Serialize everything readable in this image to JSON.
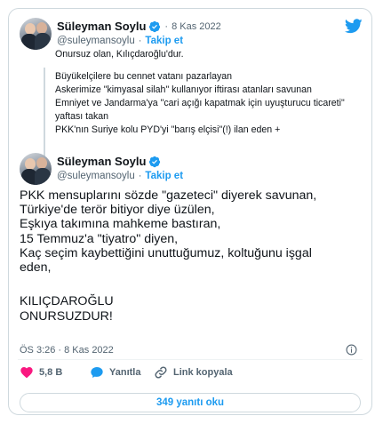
{
  "quoted_tweet": {
    "author_name": "Süleyman Soylu",
    "dot": "·",
    "date": "8 Kas 2022",
    "handle": "@suleymansoylu",
    "follow_label": "Takip et",
    "lines": [
      "Onursuz olan, Kılıçdaroğlu'dur.",
      "",
      "Büyükelçilere bu cennet vatanı pazarlayan",
      "Askerimize \"kimyasal silah\" kullanıyor iftirası atanları savunan",
      "Emniyet ve Jandarma'ya \"cari açığı kapatmak için uyuşturucu ticareti\"",
      "yaftası takan",
      "PKK'nın Suriye kolu PYD'yi \"barış elçisi\"(!) ilan eden +"
    ]
  },
  "main_tweet": {
    "author_name": "Süleyman Soylu",
    "handle": "@suleymansoylu",
    "dot": "·",
    "follow_label": "Takip et",
    "lines": [
      "PKK mensuplarını sözde \"gazeteci\" diyerek savunan,",
      "Türkiye'de terör bitiyor diye üzülen,",
      "Eşkıya takımına mahkeme bastıran,",
      "15 Temmuz'a \"tiyatro\" diyen,",
      "Kaç seçim kaybettiğini unuttuğumuz, koltuğunu işgal",
      "eden,",
      "",
      "KILIÇDAROĞLU",
      "ONURSUZDUR!"
    ],
    "timestamp": "ÖS 3:26 · 8 Kas 2022"
  },
  "actions": {
    "like_count": "5,8 B",
    "reply_label": "Yanıtla",
    "copy_link_label": "Link kopyala"
  },
  "replies_button_label": "349 yanıtı oku",
  "colors": {
    "accent": "#1d9bf0",
    "like_red": "#f91880",
    "text": "#0f1419",
    "muted": "#536471",
    "border": "#cfd9de"
  },
  "icons": [
    "verified-badge-icon",
    "twitter-bird-icon",
    "info-icon",
    "heart-icon",
    "reply-bubble-icon",
    "link-icon"
  ]
}
